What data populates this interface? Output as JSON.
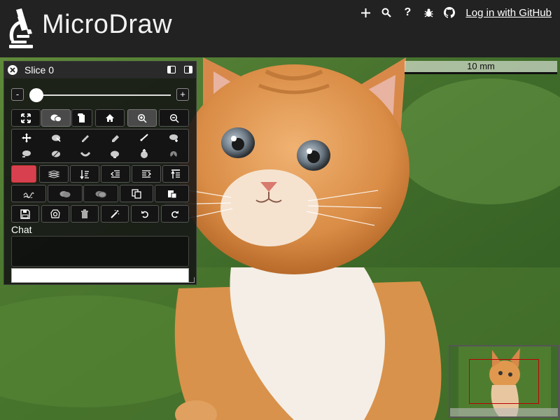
{
  "app": {
    "title": "MicroDraw",
    "login_label": "Log in with GitHub"
  },
  "header_icons": [
    "plus-icon",
    "search-icon",
    "help-icon",
    "bug-icon",
    "github-icon"
  ],
  "header_help_glyph": "?",
  "scalebar": {
    "label": "10 mm"
  },
  "panel": {
    "slice_label": "Slice 0",
    "slider": {
      "minus_label": "-",
      "plus_label": "+",
      "value": 0
    },
    "view_tools": [
      "fullscreen",
      "chat",
      "rotate",
      "home",
      "zoom-in",
      "zoom-out"
    ],
    "edit_tools": [
      "move",
      "select-region",
      "draw",
      "erase",
      "draw-bezier",
      "add-point",
      "delete-point",
      "split",
      "simplify",
      "union",
      "subtract",
      "intersect"
    ],
    "color": "#d9404f",
    "layer_tools": [
      "color",
      "layer-stack",
      "sort-down",
      "indent-decrease",
      "indent-increase",
      "sort-up"
    ],
    "region_tools": [
      "smooth",
      "unite",
      "shapes",
      "copy",
      "paste"
    ],
    "file_tools": [
      "save",
      "screenshot",
      "delete",
      "magic-wand",
      "undo",
      "redo"
    ],
    "chat_label": "Chat",
    "chat_input_placeholder": ""
  },
  "navigator": {
    "label": ""
  }
}
